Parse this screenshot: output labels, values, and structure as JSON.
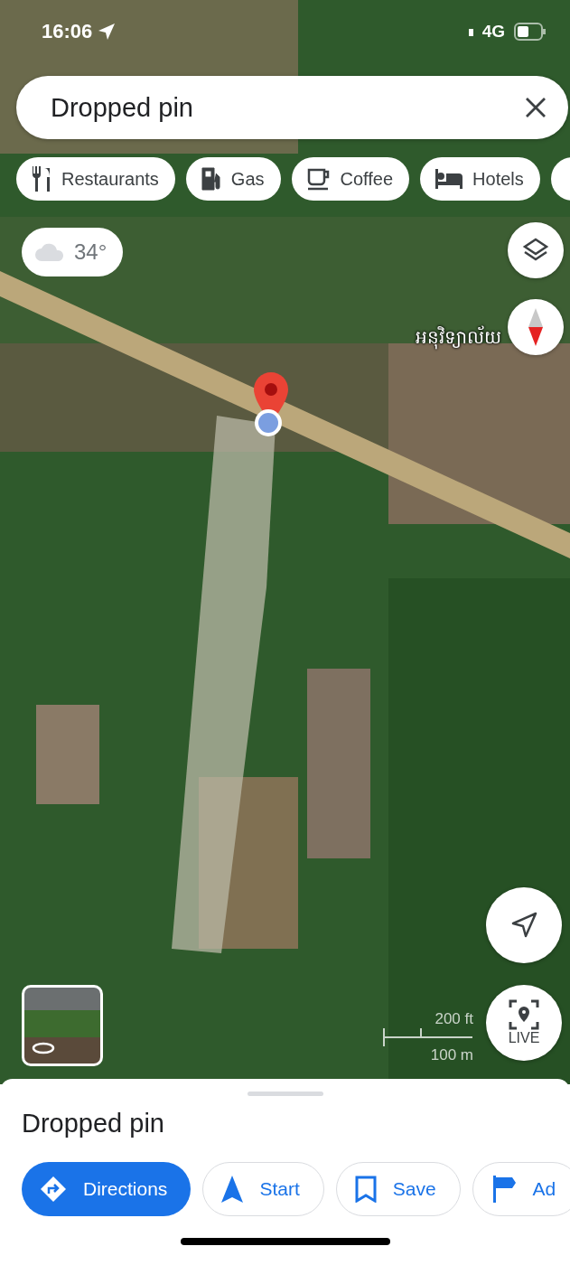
{
  "status_bar": {
    "time": "16:06",
    "network": "4G"
  },
  "search": {
    "value": "Dropped pin"
  },
  "categories": [
    {
      "label": "Restaurants",
      "kind": "restaurant"
    },
    {
      "label": "Gas",
      "kind": "gas"
    },
    {
      "label": "Coffee",
      "kind": "coffee"
    },
    {
      "label": "Hotels",
      "kind": "hotel"
    }
  ],
  "weather": {
    "temperature": "34°"
  },
  "map": {
    "place_label": "អនុវិទ្យាល័យ",
    "scale_imperial": "200 ft",
    "scale_metric": "100 m"
  },
  "live_button": {
    "label": "LIVE"
  },
  "sheet": {
    "title": "Dropped pin",
    "actions": [
      {
        "label": "Directions",
        "kind": "directions",
        "primary": true
      },
      {
        "label": "Start",
        "kind": "start",
        "primary": false
      },
      {
        "label": "Save",
        "kind": "save",
        "primary": false
      },
      {
        "label": "Ad",
        "kind": "add",
        "primary": false
      }
    ]
  }
}
